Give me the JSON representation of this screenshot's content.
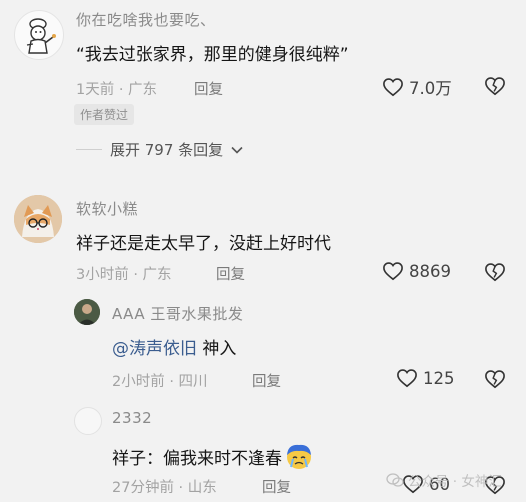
{
  "comments": [
    {
      "username": "你在吃啥我也要吃、",
      "text": "“我去过张家界，那里的健身很纯粹”",
      "meta": "1天前 · 广东",
      "reply_label": "回复",
      "likes": "7.0万",
      "badge": "作者赞过",
      "expand_label": "展开 797 条回复"
    },
    {
      "username": "软软小糕",
      "text": "祥子还是走太早了，没赶上好时代",
      "meta": "3小时前 · 广东",
      "reply_label": "回复",
      "likes": "8869"
    }
  ],
  "replies": [
    {
      "username": "AAA 王哥水果批发",
      "mention": "@涛声依旧",
      "text": " 神入",
      "meta": "2小时前 · 四川",
      "reply_label": "回复",
      "likes": "125"
    },
    {
      "username": "2332",
      "text": "祥子：偏我来时不逢春",
      "meta": "27分钟前 · 山东",
      "reply_label": "回复",
      "likes": "60"
    }
  ],
  "watermark": {
    "text": "公众号 · 女神汇"
  }
}
